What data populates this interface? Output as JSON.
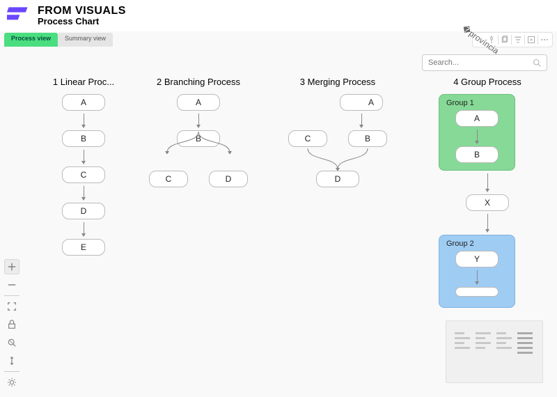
{
  "brand": "FROM VISUALS",
  "page_title": "Process Chart",
  "tabs": {
    "process": "Process view",
    "summary": "Summary view"
  },
  "search": {
    "placeholder": "Search..."
  },
  "columns": [
    {
      "title": "1 Linear Proc...",
      "nodes": [
        "A",
        "B",
        "C",
        "D",
        "E"
      ],
      "layout": "linear"
    },
    {
      "title": "2 Branching Process",
      "nodes_top": [
        "A",
        "B"
      ],
      "branches": [
        "C",
        "D"
      ],
      "layout": "branch"
    },
    {
      "title": "3 Merging Process",
      "top": "A",
      "pair": [
        "C",
        "B"
      ],
      "merged": "D",
      "layout": "merge"
    },
    {
      "title": "4 Group Process",
      "group1": {
        "label": "Group 1",
        "nodes": [
          "A",
          "B"
        ]
      },
      "mid": "X",
      "group2": {
        "label": "Group 2",
        "nodes": [
          "Y",
          ""
        ]
      },
      "layout": "group"
    }
  ]
}
